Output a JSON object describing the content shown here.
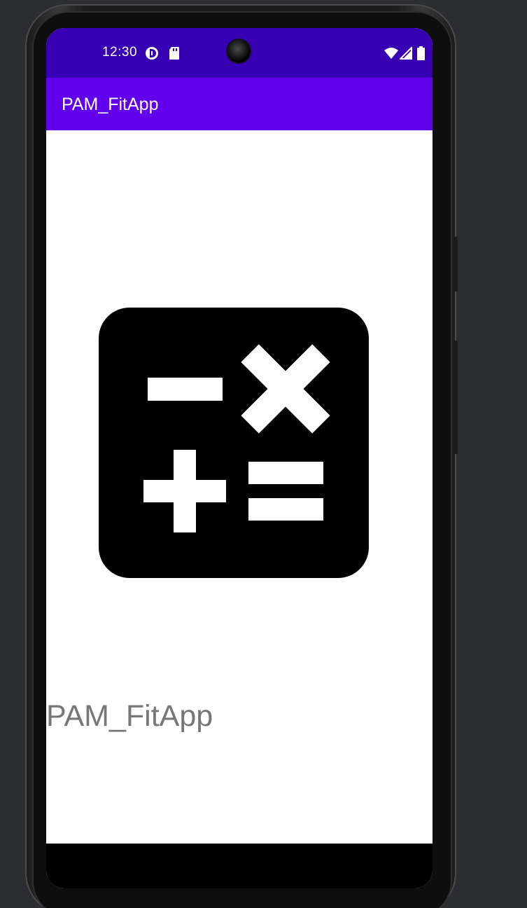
{
  "status_bar": {
    "time": "12:30",
    "icons": [
      "data-saver-icon",
      "sd-card-icon",
      "wifi-icon",
      "signal-icon",
      "battery-icon"
    ]
  },
  "app_bar": {
    "title": "PAM_FitApp"
  },
  "content": {
    "logo_icon": "calculator-icon",
    "app_name": "PAM_FitApp"
  },
  "colors": {
    "status_bar": "#3700b3",
    "app_bar": "#6200ee",
    "app_name_text": "#777777",
    "nav_bar": "#000000"
  }
}
